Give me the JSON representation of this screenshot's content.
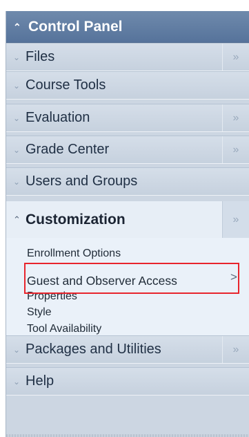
{
  "panel": {
    "title": "Control Panel",
    "items": [
      {
        "label": "Files",
        "has_flyout": true
      },
      {
        "label": "Course Tools",
        "has_flyout": false
      },
      {
        "label": "Evaluation",
        "has_flyout": true
      },
      {
        "label": "Grade Center",
        "has_flyout": true
      },
      {
        "label": "Users and Groups",
        "has_flyout": false
      }
    ],
    "expanded": {
      "label": "Customization",
      "subitems": [
        {
          "label": "Enrollment Options"
        },
        {
          "label": "Guest and Observer Access",
          "highlighted": true
        },
        {
          "label": "Properties"
        },
        {
          "label": "Style"
        },
        {
          "label": "Tool Availability"
        }
      ]
    },
    "after_items": [
      {
        "label": "Packages and Utilities",
        "has_flyout": true
      },
      {
        "label": "Help",
        "has_flyout": false
      }
    ]
  },
  "icons": {
    "expand_up": "double-chevron-up-icon",
    "collapse_down": "double-chevron-down-icon",
    "flyout": "double-chevron-right-icon",
    "submenu_arrow": "chevron-right-icon"
  },
  "colors": {
    "header": "#5f7ba2",
    "row": "#ccd6e2",
    "expanded_bg": "#eaf1f9",
    "highlight": "#e8242c"
  }
}
